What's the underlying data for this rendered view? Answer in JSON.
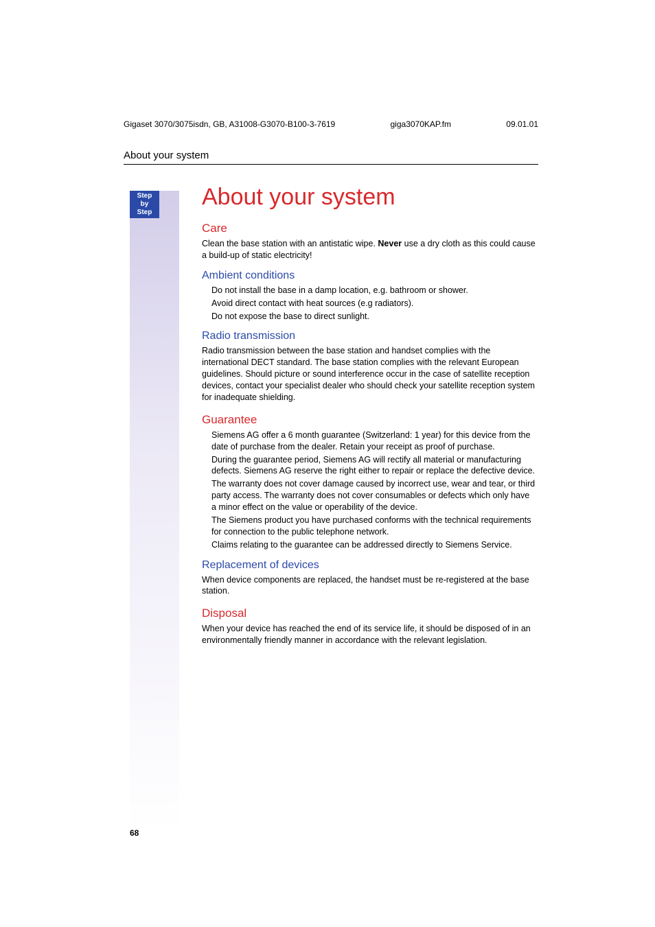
{
  "meta": {
    "doc_id": "Gigaset 3070/3075isdn, GB, A31008-G3070-B100-3-7619",
    "file": "giga3070KAP.fm",
    "date": "09.01.01"
  },
  "running_head": "About your system",
  "badge": {
    "l1": "Step",
    "l2": "by",
    "l3": "Step"
  },
  "title": "About your system",
  "care": {
    "heading": "Care",
    "p1a": "Clean the base station with an antistatic wipe. ",
    "never": "Never",
    "p1b": " use a dry cloth as this could cause a build-up of static electricity!"
  },
  "ambient": {
    "heading": "Ambient conditions",
    "b1": "Do not install the base in a damp location, e.g. bathroom or shower.",
    "b2": "Avoid direct contact with heat sources (e.g  radiators).",
    "b3": "Do not expose the base to direct sunlight."
  },
  "radio": {
    "heading": "Radio transmission",
    "p1": "Radio transmission between the base station and handset complies with the international DECT standard. The base station complies with the relevant European guidelines. Should picture or sound interference occur in the case of satellite reception devices, contact your specialist dealer who should check your satellite reception system for inadequate shielding."
  },
  "guarantee": {
    "heading": "Guarantee",
    "b1": "Siemens AG offer a 6 month guarantee (Switzerland: 1 year) for this device from the date of purchase from the dealer. Retain your receipt as proof of purchase.",
    "b2": "During the guarantee period, Siemens AG will rectify all material or manufacturing defects. Siemens AG reserve the right either to repair or replace the defective device.",
    "b3": "The warranty does not cover damage caused by incorrect use, wear and tear, or third party access. The warranty does not cover consumables or defects which only have a minor effect on the value or operability of the device.",
    "b4": "The Siemens product you have purchased conforms with the technical requirements for connection to the public telephone network.",
    "b5": "Claims relating to the guarantee can be addressed directly to Siemens Service."
  },
  "replacement": {
    "heading": "Replacement of devices",
    "p1": "When device components are replaced, the handset must be re-registered at the base station."
  },
  "disposal": {
    "heading": "Disposal",
    "p1": "When your device has reached the end of its service life, it should be disposed of in an environmentally friendly manner in accordance with the relevant legislation."
  },
  "page_number": "68"
}
